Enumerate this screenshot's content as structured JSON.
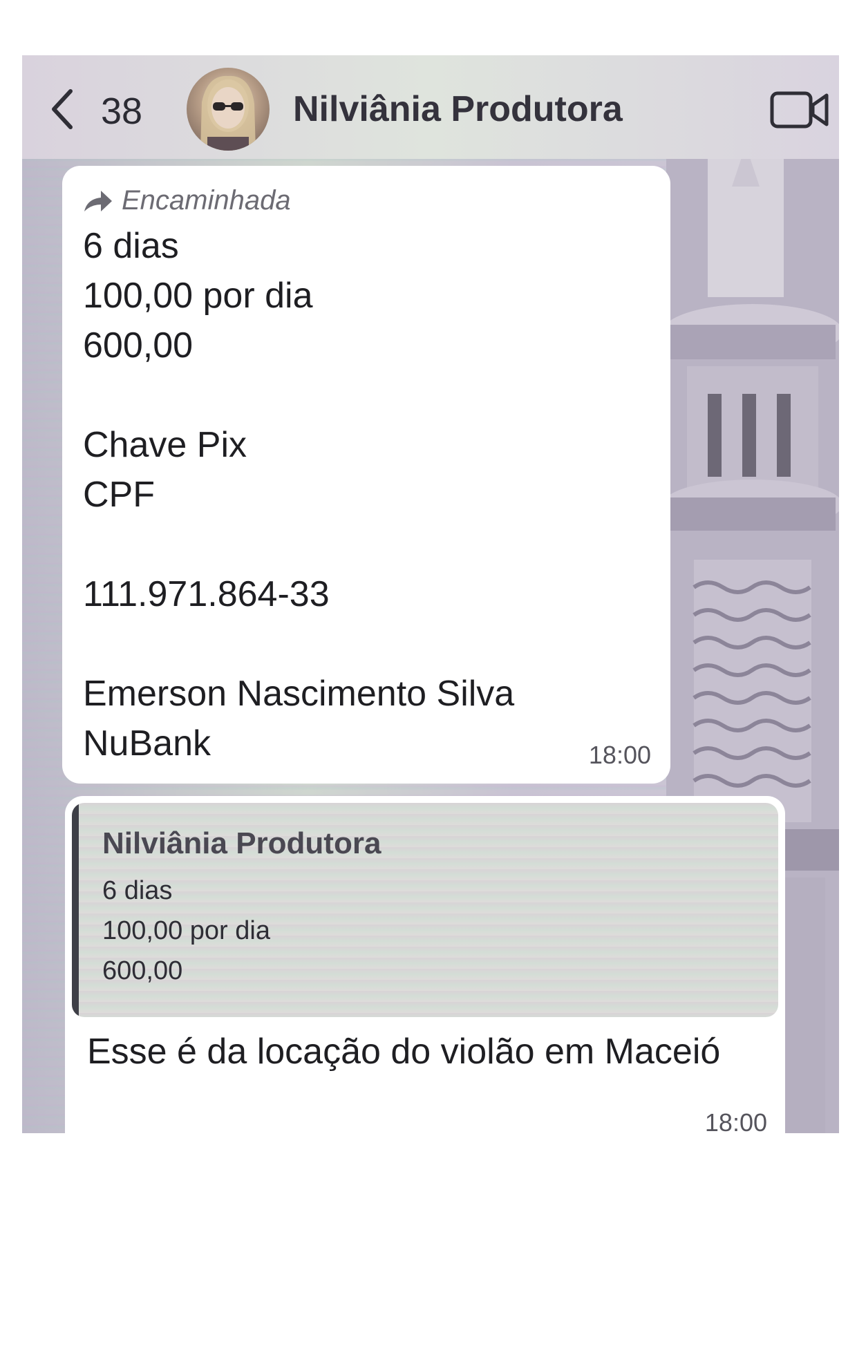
{
  "header": {
    "unread_count": "38",
    "contact_name": "Nilviânia Produtora"
  },
  "messages": [
    {
      "forwarded_label": "Encaminhada",
      "text": "6 dias\n100,00 por dia\n600,00\n\nChave Pix\nCPF\n\n111.971.864-33\n\nEmerson Nascimento Silva\nNuBank",
      "time": "18:00"
    },
    {
      "quote": {
        "author": "Nilviânia Produtora",
        "text": "6 dias\n100,00 por dia\n600,00"
      },
      "text": "Esse é da locação do violão em Maceió",
      "time": "18:00"
    }
  ],
  "icons": {
    "back": "chevron-left-icon",
    "video": "video-camera-icon",
    "forward": "forward-arrow-icon"
  }
}
